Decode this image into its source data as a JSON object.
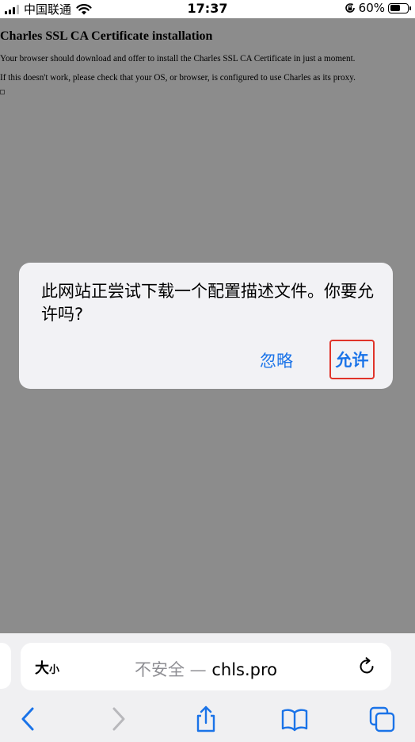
{
  "status_bar": {
    "carrier": "中国联通",
    "time": "17:37",
    "battery_percent": "60%",
    "battery_level": 0.6,
    "icons": [
      "signal-icon",
      "wifi-icon",
      "rotation-lock-icon",
      "battery-icon"
    ]
  },
  "page": {
    "heading": "Charles SSL CA Certificate installation",
    "paragraph1": "Your browser should download and offer to install the Charles SSL CA Certificate in just a moment.",
    "paragraph2": "If this doesn't work, please check that your OS, or browser, is configured to use Charles as its proxy."
  },
  "alert": {
    "message": "此网站正尝试下载一个配置描述文件。你要允许吗?",
    "ignore_label": "忽略",
    "allow_label": "允许",
    "button_color": "#1a73e8",
    "highlight_color": "#e0342a"
  },
  "address_bar": {
    "text_size_big": "大",
    "text_size_small": "小",
    "security_label": "不安全 —",
    "domain": "chls.pro",
    "icons": [
      "reload-icon"
    ]
  },
  "toolbar": {
    "icons": [
      "back-icon",
      "forward-icon",
      "share-icon",
      "bookmarks-icon",
      "tabs-icon"
    ],
    "accent_color": "#1a73e8"
  }
}
